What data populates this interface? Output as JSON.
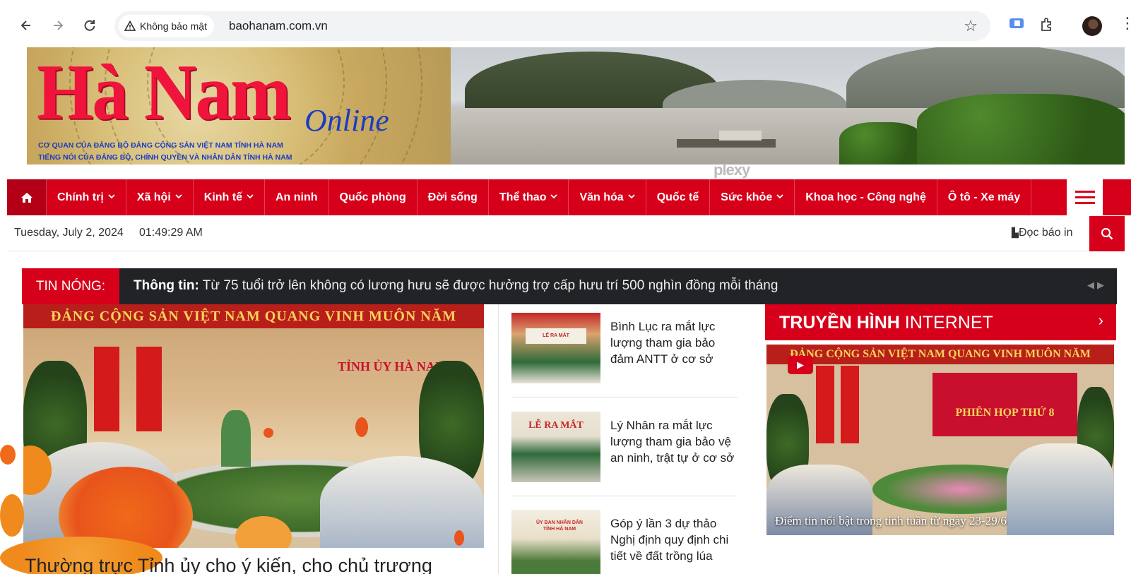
{
  "browser": {
    "security_label": "Không bảo mật",
    "url": "baohanam.com.vn"
  },
  "banner": {
    "logo_text": "Hà Nam",
    "logo_suffix": "Online",
    "subtitle_1": "CƠ QUAN CỦA ĐẢNG BỘ ĐẢNG CỘNG SẢN VIỆT NAM TỈNH HÀ NAM",
    "subtitle_2": "TIẾNG NÓI CỦA ĐẢNG BỘ, CHÍNH QUYỀN VÀ NHÂN DÂN TỈNH HÀ NAM",
    "watermark": "plexy"
  },
  "nav": {
    "home_icon": "home-icon",
    "items": [
      {
        "label": "Chính trị",
        "dropdown": true
      },
      {
        "label": "Xã hội",
        "dropdown": true
      },
      {
        "label": "Kinh tế",
        "dropdown": true
      },
      {
        "label": "An ninh",
        "dropdown": false
      },
      {
        "label": "Quốc phòng",
        "dropdown": false
      },
      {
        "label": "Đời sống",
        "dropdown": false
      },
      {
        "label": "Thể thao",
        "dropdown": true
      },
      {
        "label": "Văn hóa",
        "dropdown": true
      },
      {
        "label": "Quốc tế",
        "dropdown": false
      },
      {
        "label": "Sức khỏe",
        "dropdown": true
      },
      {
        "label": "Khoa học - Công nghệ",
        "dropdown": false
      },
      {
        "label": "Ô tô - Xe máy",
        "dropdown": false
      }
    ]
  },
  "date_bar": {
    "date": "Tuesday, July 2, 2024",
    "time": "01:49:29 AM",
    "print_label": "Đọc báo in"
  },
  "ticker": {
    "label": "TIN NÓNG:",
    "prefix": "Thông tin:",
    "text": " Từ 75 tuổi trở lên không có lương hưu sẽ được hưởng trợ cấp hưu trí 500 nghìn đồng mỗi tháng"
  },
  "lead": {
    "image_banner": "ĐẢNG CỘNG SẢN VIỆT NAM QUANG VINH MUÔN NĂM",
    "image_sign": "TỈNH ỦY HÀ NAM",
    "title": "Thường trực Tỉnh ủy cho ý kiến, cho chủ trương"
  },
  "side_news": [
    {
      "title": "Bình Lục ra mắt lực lượng tham gia bảo đảm ANTT ở cơ sở",
      "thumb_text": "LỄ RA MẮT"
    },
    {
      "title": "Lý Nhân ra mắt lực lượng tham gia bảo vệ an ninh, trật tự ở cơ sở",
      "thumb_text": "LỄ RA MẮT"
    },
    {
      "title": "Góp ý lần 3 dự thảo Nghị định quy định chi tiết về đất trồng lúa",
      "thumb_text": "ỦY BAN NHÂN DÂN TỈNH HÀ NAM"
    }
  ],
  "tv": {
    "title_bold": "TRUYỀN HÌNH",
    "title_rest": " INTERNET",
    "video_banner": "ĐẢNG CỘNG SẢN VIỆT NAM QUANG VINH MUÔN NĂM",
    "board_text": "PHIÊN HỌP THỨ 8",
    "caption": "Điểm tin nổi bật trong tỉnh tuần từ ngày 23-29/6"
  },
  "colors": {
    "brand_red": "#d7001b",
    "ticker_bg": "#222327"
  }
}
